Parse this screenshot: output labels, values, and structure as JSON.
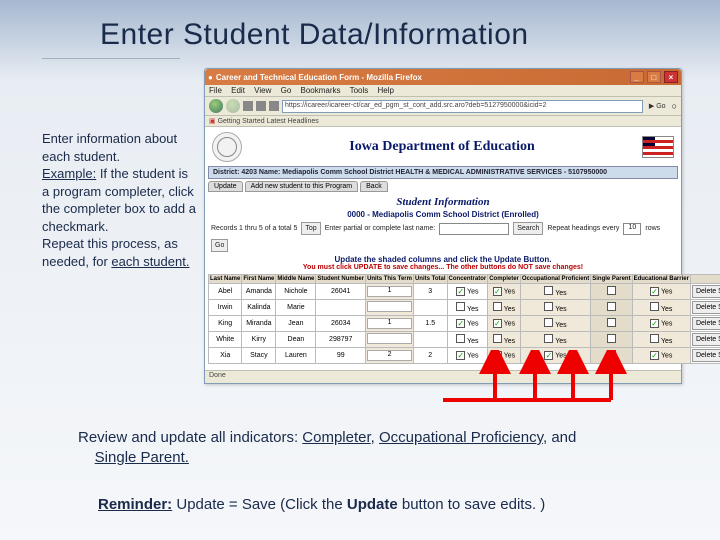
{
  "slide": {
    "title": "Enter Student Data/Information"
  },
  "instruction": {
    "p1": "Enter information about each student.",
    "ex_label": "Example:",
    "ex_text": " If the student is a program completer, click the completer box to add a checkmark.",
    "p2a": "Repeat this process, as needed, for ",
    "p2_u": "each student.",
    "p2b": ""
  },
  "browser": {
    "title": "Career and Technical Education Form - Mozilla Firefox",
    "menu": [
      "File",
      "Edit",
      "View",
      "Go",
      "Bookmarks",
      "Tools",
      "Help"
    ],
    "url": "https://icareer/icareer-ct/car_ed_pgm_st_cont_add.src.aro?deb=5127950000&icid=2",
    "go": "Go",
    "bookmarks": "Getting Started   Latest Headlines"
  },
  "page": {
    "header": "Iowa Department of Education",
    "district": "District: 4203   Name: Mediapolis Comm School District   HEALTH & MEDICAL ADMINISTRATIVE SERVICES - 5107950000",
    "tabs": {
      "update": "Update",
      "add": "Add new student to this Program",
      "back": "Back"
    },
    "si_title": "Student Information",
    "si_sub": "0000 - Mediapolis Comm School District (Enrolled)",
    "controls": {
      "records": "Records 1 thru 5 of a total 5",
      "top": "Top",
      "partial": "Enter partial or complete last name:",
      "search": "Search",
      "repeat_a": "Repeat headings every",
      "repeat_val": "10",
      "repeat_b": "rows",
      "go": "Go"
    },
    "notice1": "Update the shaded columns and click the Update Button.",
    "notice2": "You must click UPDATE to save changes... The other buttons do NOT save changes!"
  },
  "table": {
    "headers": [
      "Last Name",
      "First Name",
      "Middle Name",
      "Student Number",
      "Units This Term",
      "Units Total",
      "Concentrator",
      "Completer",
      "Occupational Proficient",
      "Single Parent",
      "Educational Barrier",
      ""
    ],
    "delete_label": "Delete Student",
    "rows": [
      {
        "last": "Abel",
        "first": "Amanda",
        "middle": "Nichole",
        "num": "26041",
        "ut": "1",
        "tot": "3",
        "conc": true,
        "comp": true,
        "occ": false,
        "sp": false,
        "eb": true
      },
      {
        "last": "Irwin",
        "first": "Kalinda",
        "middle": "Marie",
        "num": "",
        "ut": "",
        "tot": "",
        "conc": false,
        "comp": false,
        "occ": false,
        "sp": false,
        "eb": false
      },
      {
        "last": "King",
        "first": "Miranda",
        "middle": "Jean",
        "num": "26034",
        "ut": "1",
        "tot": "1.5",
        "conc": true,
        "comp": true,
        "occ": false,
        "sp": false,
        "eb": true
      },
      {
        "last": "White",
        "first": "Kirry",
        "middle": "Dean",
        "num": "298797",
        "ut": "",
        "tot": "",
        "conc": false,
        "comp": false,
        "occ": false,
        "sp": false,
        "eb": false
      },
      {
        "last": "Xia",
        "first": "Stacy",
        "middle": "Lauren",
        "num": "99",
        "ut": "2",
        "tot": "2",
        "conc": true,
        "comp": true,
        "occ": true,
        "sp": false,
        "eb": true
      }
    ]
  },
  "status": "Done",
  "review": {
    "a": "Review and update all indicators: ",
    "c": "Completer",
    "sep1": ", ",
    "o": "Occupational Proficiency",
    "sep2": ", and ",
    "s": "Single Parent."
  },
  "reminder": {
    "label": "Reminder:",
    "text": "  Update = Save   (Click the ",
    "bold": "Update",
    "text2": " button to save edits. )"
  }
}
